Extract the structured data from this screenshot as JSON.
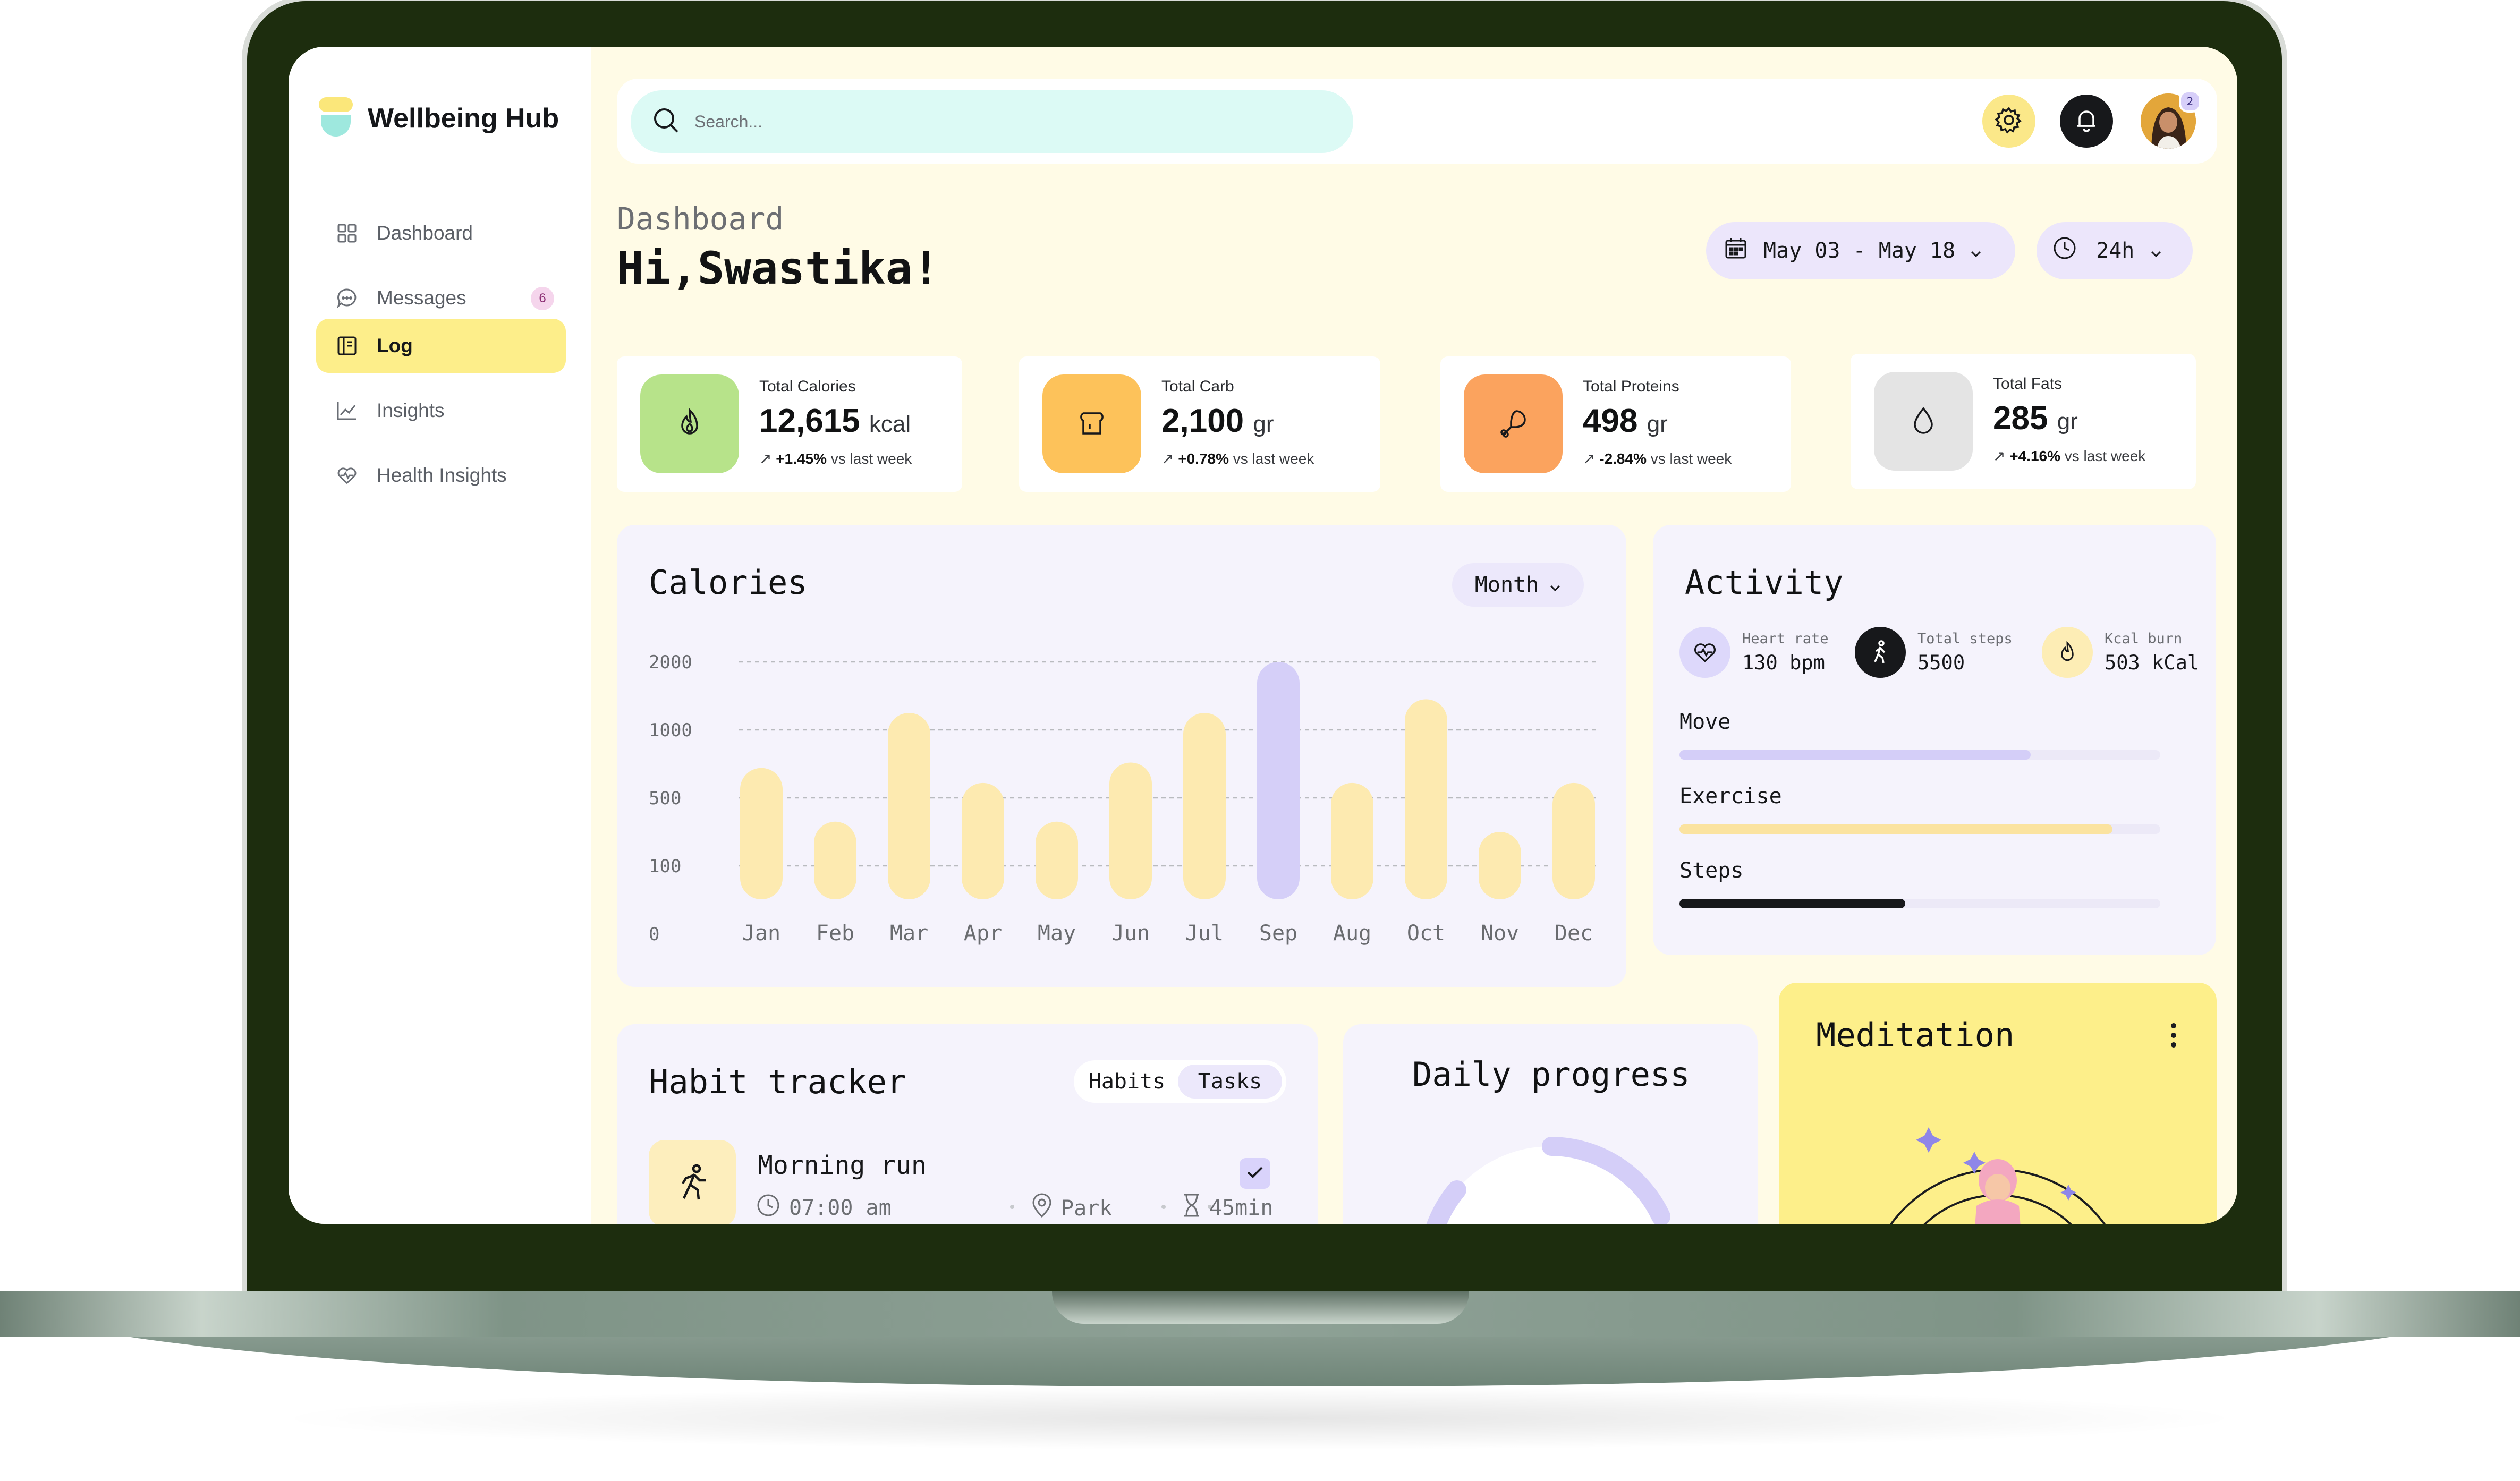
{
  "app": {
    "name": "Wellbeing Hub"
  },
  "sidebar": {
    "items": [
      {
        "label": "Dashboard",
        "icon": "grid-icon"
      },
      {
        "label": "Messages",
        "icon": "chat-icon",
        "badge": "6"
      },
      {
        "label": "Log",
        "icon": "log-icon",
        "active": true
      },
      {
        "label": "Insights",
        "icon": "chart-line-icon"
      },
      {
        "label": "Health Insights",
        "icon": "heart-pulse-icon"
      }
    ]
  },
  "topbar": {
    "search_placeholder": "Search...",
    "avatar_badge": "2"
  },
  "header": {
    "breadcrumb": "Dashboard",
    "greeting": "Hi,Swastika!",
    "date_range": "May 03 - May 18",
    "time_range": "24h"
  },
  "stats": [
    {
      "title": "Total Calories",
      "value": "12,615",
      "unit": "kcal",
      "change": "+1.45%",
      "suffix": "vs last week",
      "color": "#b7e38a"
    },
    {
      "title": "Total Carb",
      "value": "2,100",
      "unit": "gr",
      "change": "+0.78%",
      "suffix": "vs last week",
      "color": "#fdc25a"
    },
    {
      "title": "Total Proteins",
      "value": "498",
      "unit": "gr",
      "change": "-2.84%",
      "suffix": "vs last week",
      "color": "#fba35e"
    },
    {
      "title": "Total Fats",
      "value": "285",
      "unit": "gr",
      "change": "+4.16%",
      "suffix": "vs last week",
      "color": "#e4e4e4"
    }
  ],
  "calories": {
    "title": "Calories",
    "filter": "Month"
  },
  "chart_data": {
    "type": "bar",
    "title": "Calories",
    "categories": [
      "Jan",
      "Feb",
      "Mar",
      "Apr",
      "May",
      "Jun",
      "Jul",
      "Sep",
      "Aug",
      "Oct",
      "Nov",
      "Dec"
    ],
    "values": [
      720,
      360,
      1250,
      610,
      360,
      760,
      1250,
      2000,
      610,
      1450,
      300,
      610
    ],
    "highlight": "Sep",
    "y_ticks": [
      "0",
      "100",
      "500",
      "1000",
      "2000"
    ],
    "bar_color": "#fdeab0",
    "highlight_color": "#d5cff8",
    "grid": "dashed"
  },
  "activity": {
    "title": "Activity",
    "metrics": [
      {
        "label": "Heart rate",
        "value": "130 bpm",
        "icon": "heart-pulse-icon"
      },
      {
        "label": "Total steps",
        "value": "5500",
        "icon": "walking-icon"
      },
      {
        "label": "Kcal burn",
        "value": "503 kCal",
        "icon": "flame-icon"
      }
    ],
    "bars": [
      {
        "label": "Move",
        "fraction": 0.73,
        "color": "#d4cef8"
      },
      {
        "label": "Exercise",
        "fraction": 0.9,
        "color": "#fbe3a0"
      },
      {
        "label": "Steps",
        "fraction": 0.47,
        "color": "#17181b"
      }
    ]
  },
  "habits": {
    "title": "Habit tracker",
    "tabs": [
      "Habits",
      "Tasks"
    ],
    "items": [
      {
        "name": "Morning run",
        "time": "07:00 am",
        "place": "Park",
        "duration": "45min",
        "done": true
      }
    ]
  },
  "daily": {
    "title": "Daily progress"
  },
  "meditation": {
    "title": "Meditation"
  }
}
